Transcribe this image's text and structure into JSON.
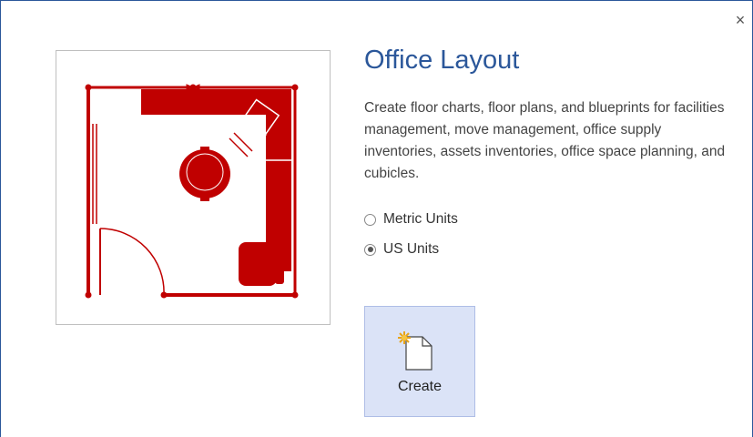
{
  "dialog": {
    "close_label": "×",
    "title": "Office Layout",
    "description": "Create floor charts, floor plans, and blueprints for facilities management, move management, office supply inventories, assets inventories, office space planning, and cubicles.",
    "units": [
      {
        "label": "Metric Units",
        "selected": false
      },
      {
        "label": "US Units",
        "selected": true
      }
    ],
    "create_label": "Create",
    "accent_color": "#2b579a",
    "preview_color": "#c00000"
  }
}
